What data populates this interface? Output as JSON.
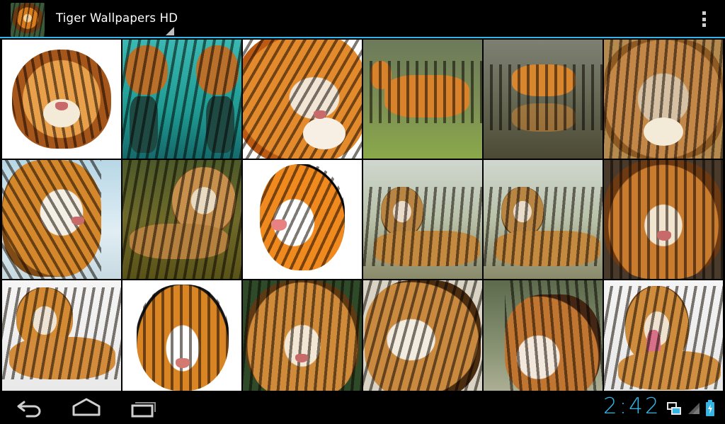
{
  "actionbar": {
    "title": "Tiger Wallpapers HD",
    "app_icon": "tiger-app-icon",
    "overflow_icon": "overflow-menu-icon",
    "accent_color": "#33b5e5"
  },
  "gallery": {
    "columns": 6,
    "rows": 3,
    "thumbnails": [
      {
        "icon": "tiger-head-photo"
      },
      {
        "icon": "tiger-mirror-photo"
      },
      {
        "icon": "tiger-roar-photo"
      },
      {
        "icon": "tiger-standing-photo"
      },
      {
        "icon": "tiger-water-photo"
      },
      {
        "icon": "tiger-face-photo"
      },
      {
        "icon": "tiger-painting-photo"
      },
      {
        "icon": "tiger-swimming-photo"
      },
      {
        "icon": "tiger-drawing-photo"
      },
      {
        "icon": "tiger-lying-photo"
      },
      {
        "icon": "tiger-lying-photo"
      },
      {
        "icon": "tiger-closeup-photo"
      },
      {
        "icon": "tiger-snow-photo"
      },
      {
        "icon": "tiger-cartoon-photo"
      },
      {
        "icon": "tiger-face-photo"
      },
      {
        "icon": "tiger-face-photo"
      },
      {
        "icon": "tiger-profile-photo"
      },
      {
        "icon": "tiger-yawn-photo"
      }
    ]
  },
  "navbar": {
    "back_icon": "back-icon",
    "home_icon": "home-icon",
    "recents_icon": "recents-icon"
  },
  "status": {
    "clock": "2:42",
    "clock_color": "#33b5e5",
    "network_icon": "network-icon",
    "signal_icon": "signal-icon",
    "battery_icon": "battery-charging-icon"
  }
}
